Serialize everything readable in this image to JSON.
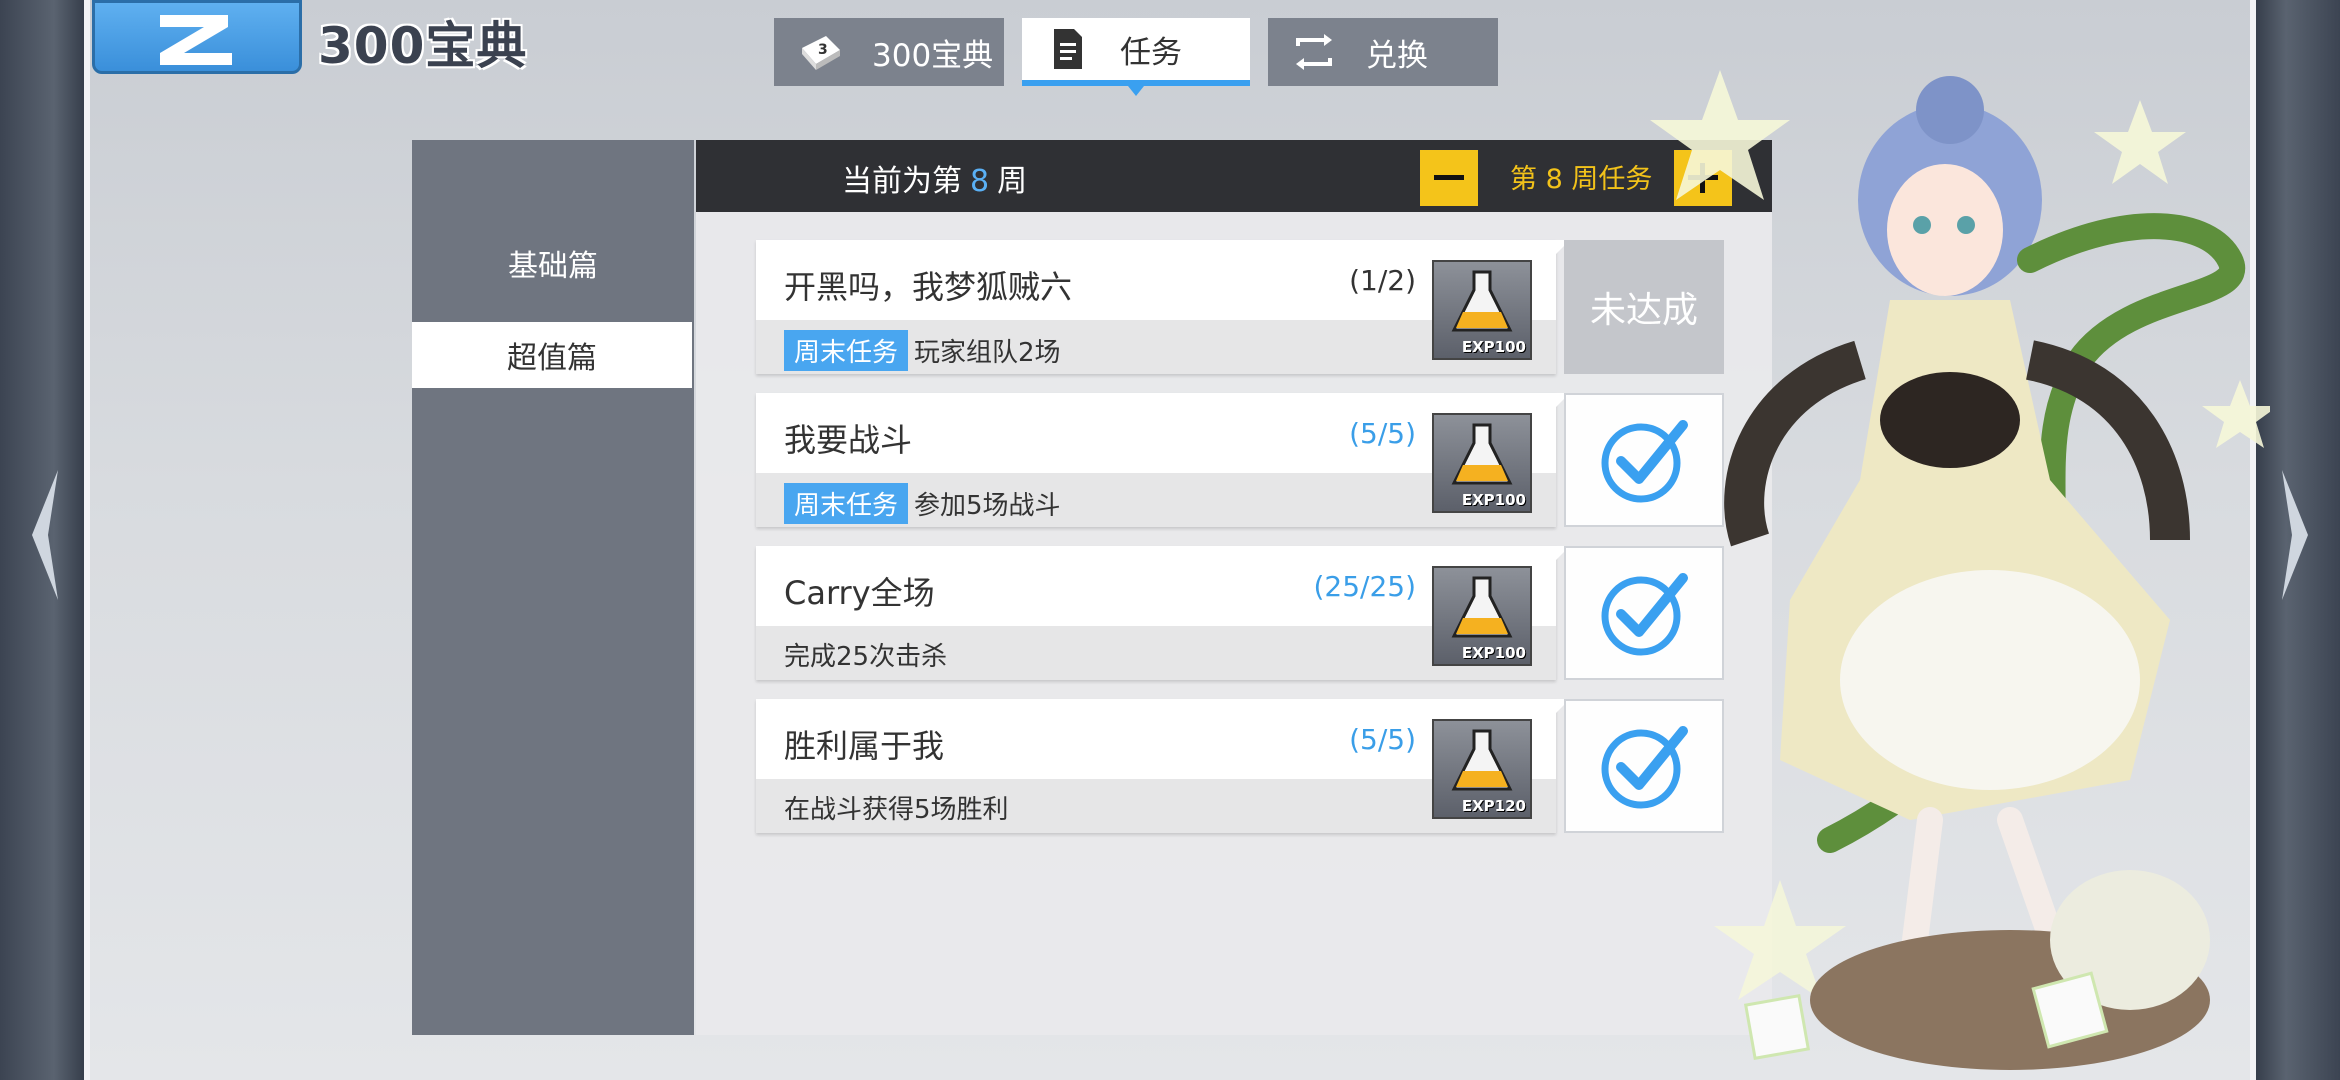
{
  "header": {
    "logo_glyph": "Z",
    "title": "300宝典"
  },
  "tabs": [
    {
      "label": "300宝典",
      "icon": "book-icon",
      "active": false
    },
    {
      "label": "任务",
      "icon": "document-icon",
      "active": true
    },
    {
      "label": "兑换",
      "icon": "exchange-icon",
      "active": false
    }
  ],
  "sidebar": {
    "items": [
      {
        "label": "基础篇",
        "active": false
      },
      {
        "label": "超值篇",
        "active": true
      }
    ]
  },
  "week": {
    "prefix": "当前为第",
    "number": "8",
    "suffix": "周",
    "selector_label": "第 8 周任务",
    "minus_icon": "minus-icon",
    "plus_icon": "plus-icon"
  },
  "tasks": [
    {
      "name": "开黑吗，我梦狐贼六",
      "progress": "(1/2)",
      "tag": "周末任务",
      "desc": "玩家组队2场",
      "reward": "EXP100",
      "status": "未达成",
      "completed": false
    },
    {
      "name": "我要战斗",
      "progress": "(5/5)",
      "tag": "周末任务",
      "desc": "参加5场战斗",
      "reward": "EXP100",
      "status": "checkmark-icon",
      "completed": true
    },
    {
      "name": "Carry全场",
      "progress": "(25/25)",
      "tag": "",
      "desc": "完成25次击杀",
      "reward": "EXP100",
      "status": "checkmark-icon",
      "completed": true
    },
    {
      "name": "胜利属于我",
      "progress": "(5/5)",
      "tag": "",
      "desc": "在战斗获得5场胜利",
      "reward": "EXP120",
      "status": "checkmark-icon",
      "completed": true
    }
  ],
  "colors": {
    "accent_blue": "#49a6f0",
    "progress_incomplete": "#333333",
    "progress_complete": "#3a9ee8",
    "week_yellow": "#f4c41a"
  }
}
